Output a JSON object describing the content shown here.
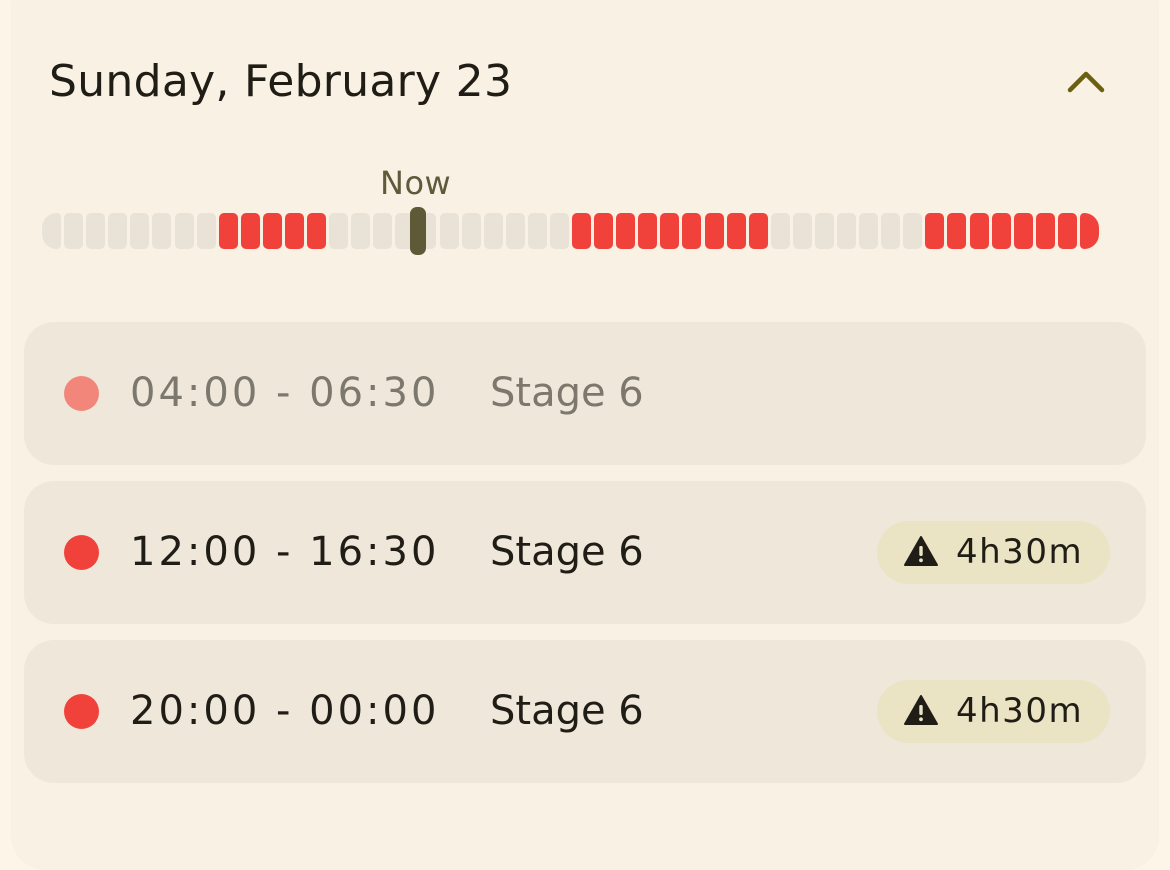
{
  "header": {
    "date_title": "Sunday, February 23",
    "collapse_icon": "chevron-up-icon"
  },
  "timeline": {
    "now_label": "Now",
    "segments_per_hour": 2,
    "now_segment_index": 17,
    "outage_segments": [
      8,
      9,
      10,
      11,
      12,
      24,
      25,
      26,
      27,
      28,
      29,
      30,
      31,
      32,
      40,
      41,
      42,
      43,
      44,
      45,
      46,
      47
    ],
    "colors": {
      "outage": "#f0423b",
      "free": "#e8e2d7",
      "now": "#5e5936"
    }
  },
  "slots": [
    {
      "time": "04:00 - 06:30",
      "stage": "Stage 6",
      "state": "past",
      "duration": ""
    },
    {
      "time": "12:00 - 16:30",
      "stage": "Stage 6",
      "state": "upcoming",
      "duration": "4h30m",
      "badge_icon": "warning-icon"
    },
    {
      "time": "20:00 - 00:00",
      "stage": "Stage 6",
      "state": "upcoming",
      "duration": "4h30m",
      "badge_icon": "warning-icon"
    }
  ]
}
